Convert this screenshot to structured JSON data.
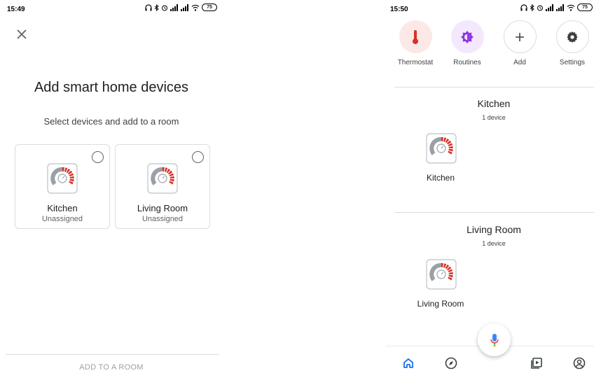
{
  "left": {
    "status_time": "15:49",
    "battery": "75",
    "title": "Add smart home devices",
    "subtitle": "Select devices and add to a room",
    "devices": [
      {
        "name": "Kitchen",
        "status": "Unassigned"
      },
      {
        "name": "Living Room",
        "status": "Unassigned"
      }
    ],
    "bottom_action": "ADD TO A ROOM"
  },
  "right": {
    "status_time": "15:50",
    "battery": "75",
    "actions": [
      {
        "label": "Thermostat",
        "icon": "thermometer-icon"
      },
      {
        "label": "Routines",
        "icon": "routines-icon"
      },
      {
        "label": "Add",
        "icon": "plus-icon"
      },
      {
        "label": "Settings",
        "icon": "gear-icon"
      }
    ],
    "rooms": [
      {
        "title": "Kitchen",
        "count": "1 device",
        "device_name": "Kitchen"
      },
      {
        "title": "Living Room",
        "count": "1 device",
        "device_name": "Living Room"
      }
    ],
    "nav": [
      "home-icon",
      "compass-icon",
      "media-icon",
      "account-icon"
    ]
  },
  "colors": {
    "thermostat_red": "#d93025",
    "routines_purple": "#9334e6",
    "home_blue": "#1a73e8",
    "gauge_gray": "#9aa0a6"
  }
}
